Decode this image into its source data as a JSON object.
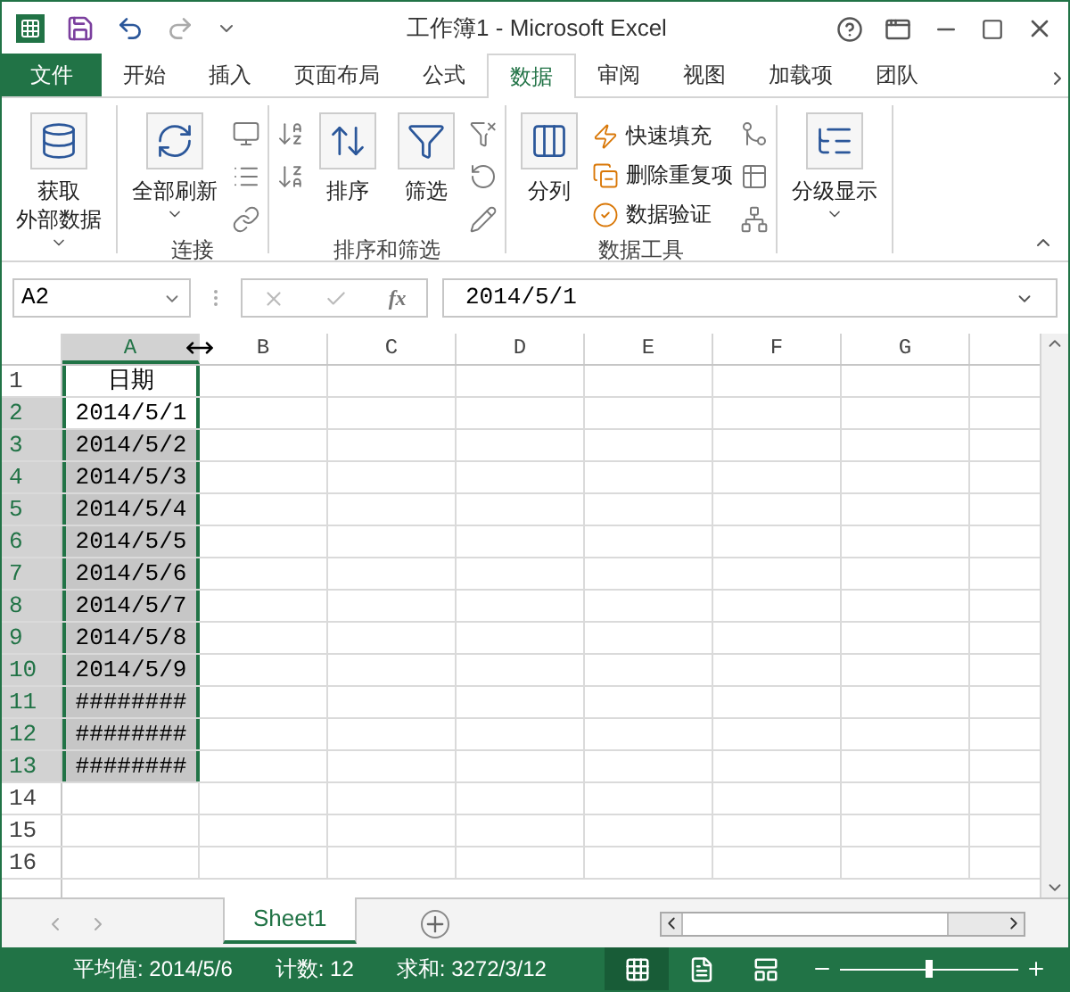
{
  "window": {
    "title": "工作簿1 - Microsoft Excel"
  },
  "ribbon_tabs": [
    {
      "label": "文件",
      "kind": "file",
      "selected": false
    },
    {
      "label": "开始",
      "kind": "tab",
      "selected": false
    },
    {
      "label": "插入",
      "kind": "tab",
      "selected": false
    },
    {
      "label": "页面布局",
      "kind": "tab",
      "selected": false
    },
    {
      "label": "公式",
      "kind": "tab",
      "selected": false
    },
    {
      "label": "数据",
      "kind": "tab",
      "selected": true
    },
    {
      "label": "审阅",
      "kind": "tab",
      "selected": false
    },
    {
      "label": "视图",
      "kind": "tab",
      "selected": false
    },
    {
      "label": "加载项",
      "kind": "tab",
      "selected": false
    },
    {
      "label": "团队",
      "kind": "tab",
      "selected": false
    }
  ],
  "ribbon_groups": [
    {
      "items": [
        {
          "kind": "large",
          "lines": [
            "获取",
            "外部数据"
          ],
          "dropdown": true
        }
      ]
    },
    {
      "label": "连接",
      "items": [
        {
          "kind": "large",
          "lines": [
            "全部刷新"
          ],
          "dropdown": true
        },
        {
          "kind": "icons"
        }
      ]
    },
    {
      "label": "排序和筛选",
      "items": [
        {
          "kind": "icons"
        },
        {
          "kind": "large",
          "lines": [
            "排序"
          ],
          "dropdown": false
        },
        {
          "kind": "large",
          "lines": [
            "筛选"
          ],
          "dropdown": false
        },
        {
          "kind": "icons"
        }
      ]
    },
    {
      "label": "数据工具",
      "items": [
        {
          "kind": "large",
          "lines": [
            "分列"
          ],
          "dropdown": false
        },
        {
          "kind": "small",
          "entries": [
            {
              "label": "快速填充"
            },
            {
              "label": "删除重复项"
            },
            {
              "label": "数据验证"
            }
          ]
        },
        {
          "kind": "icons"
        }
      ]
    },
    {
      "items": [
        {
          "kind": "large",
          "lines": [
            "分级显示"
          ],
          "dropdown": true
        }
      ]
    }
  ],
  "name_box": {
    "value": "A2"
  },
  "formula_bar": {
    "function_label": "fx",
    "value": "2014/5/1"
  },
  "columns": [
    {
      "label": "A",
      "selected": true
    },
    {
      "label": "B",
      "selected": false
    },
    {
      "label": "C",
      "selected": false
    },
    {
      "label": "D",
      "selected": false
    },
    {
      "label": "E",
      "selected": false
    },
    {
      "label": "F",
      "selected": false
    },
    {
      "label": "G",
      "selected": false
    }
  ],
  "rows": [
    {
      "number": "1",
      "selected": false,
      "value": "日期"
    },
    {
      "number": "2",
      "selected": true,
      "value": "2014/5/1"
    },
    {
      "number": "3",
      "selected": true,
      "value": "2014/5/2"
    },
    {
      "number": "4",
      "selected": true,
      "value": "2014/5/3"
    },
    {
      "number": "5",
      "selected": true,
      "value": "2014/5/4"
    },
    {
      "number": "6",
      "selected": true,
      "value": "2014/5/5"
    },
    {
      "number": "7",
      "selected": true,
      "value": "2014/5/6"
    },
    {
      "number": "8",
      "selected": true,
      "value": "2014/5/7"
    },
    {
      "number": "9",
      "selected": true,
      "value": "2014/5/8"
    },
    {
      "number": "10",
      "selected": true,
      "value": "2014/5/9"
    },
    {
      "number": "11",
      "selected": true,
      "value": "########"
    },
    {
      "number": "12",
      "selected": true,
      "value": "########"
    },
    {
      "number": "13",
      "selected": true,
      "value": "########"
    },
    {
      "number": "14",
      "selected": false
    },
    {
      "number": "15",
      "selected": false
    },
    {
      "number": "16",
      "selected": false
    }
  ],
  "sheet_tabs": [
    {
      "label": "Sheet1",
      "selected": true
    }
  ],
  "status_bar": {
    "items": [
      "平均值: 2014/5/6",
      "计数: 12",
      "求和: 3272/3/12"
    ],
    "views": [
      {
        "kind": "normal",
        "selected": true
      },
      {
        "kind": "page-layout",
        "selected": false
      },
      {
        "kind": "page-break",
        "selected": false
      }
    ],
    "zoom": {
      "level": 0.5
    }
  }
}
